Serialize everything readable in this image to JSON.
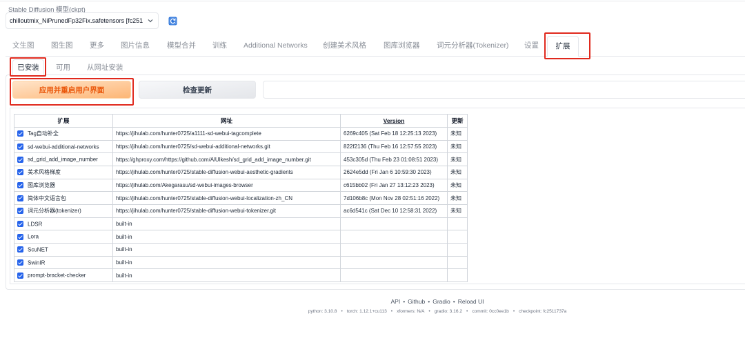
{
  "model_selector": {
    "label": "Stable Diffusion 模型(ckpt)",
    "value": "chilloutmix_NiPrunedFp32Fix.safetensors [fc251",
    "dropdown_icon": "chevron-down-icon",
    "refresh_icon": "refresh-icon"
  },
  "tabs": [
    {
      "label": "文生图"
    },
    {
      "label": "图生图"
    },
    {
      "label": "更多"
    },
    {
      "label": "图片信息"
    },
    {
      "label": "模型合并"
    },
    {
      "label": "训练"
    },
    {
      "label": "Additional Networks"
    },
    {
      "label": "创建美术风格"
    },
    {
      "label": "图库浏览器"
    },
    {
      "label": "词元分析器(Tokenizer)"
    },
    {
      "label": "设置"
    },
    {
      "label": "扩展",
      "selected": true
    }
  ],
  "subtabs": [
    {
      "label": "已安装",
      "selected": true
    },
    {
      "label": "可用"
    },
    {
      "label": "从网址安装"
    }
  ],
  "actions": {
    "apply_label": "应用并重启用户界面",
    "check_label": "检查更新"
  },
  "extensions_table": {
    "headers": {
      "name": "扩展",
      "url": "网址",
      "version": "Version",
      "update": "更新"
    },
    "rows": [
      {
        "checked": true,
        "name": "Tag自动补全",
        "url": "https://jihulab.com/hunter0725/a1111-sd-webui-tagcomplete",
        "version": "6269c405 (Sat Feb 18 12:25:13 2023)",
        "update": "未知"
      },
      {
        "checked": true,
        "name": "sd-webui-additional-networks",
        "url": "https://jihulab.com/hunter0725/sd-webui-additional-networks.git",
        "version": "822f2136 (Thu Feb 16 12:57:55 2023)",
        "update": "未知"
      },
      {
        "checked": true,
        "name": "sd_grid_add_image_number",
        "url": "https://ghproxy.com/https://github.com/AlUlkesh/sd_grid_add_image_number.git",
        "version": "453c305d (Thu Feb 23 01:08:51 2023)",
        "update": "未知"
      },
      {
        "checked": true,
        "name": "美术风格梯度",
        "url": "https://jihulab.com/hunter0725/stable-diffusion-webui-aesthetic-gradients",
        "version": "2624e5dd (Fri Jan 6 10:59:30 2023)",
        "update": "未知"
      },
      {
        "checked": true,
        "name": "图库浏览器",
        "url": "https://jihulab.com/Akegarasu/sd-webui-images-browser",
        "version": "c615bb02 (Fri Jan 27 13:12:23 2023)",
        "update": "未知"
      },
      {
        "checked": true,
        "name": "简体中文语言包",
        "url": "https://jihulab.com/hunter0725/stable-diffusion-webui-localization-zh_CN",
        "version": "7d106b8c (Mon Nov 28 02:51:16 2022)",
        "update": "未知"
      },
      {
        "checked": true,
        "name": "词元分析器(tokenizer)",
        "url": "https://jihulab.com/hunter0725/stable-diffusion-webui-tokenizer.git",
        "version": "ac6d541c (Sat Dec 10 12:58:31 2022)",
        "update": "未知"
      },
      {
        "checked": true,
        "name": "LDSR",
        "url": "built-in"
      },
      {
        "checked": true,
        "name": "Lora",
        "url": "built-in"
      },
      {
        "checked": true,
        "name": "ScuNET",
        "url": "built-in"
      },
      {
        "checked": true,
        "name": "SwinIR",
        "url": "built-in"
      },
      {
        "checked": true,
        "name": "prompt-bracket-checker",
        "url": "built-in"
      }
    ]
  },
  "footer": {
    "separator": "•",
    "links": [
      "API",
      "Github",
      "Gradio",
      "Reload UI"
    ],
    "versions": [
      "python: 3.10.8",
      "torch: 1.12.1+cu113",
      "xformers: N/A",
      "gradio: 3.16.2",
      "commit: 0cc0ee1b",
      "checkpoint: fc2511737a"
    ]
  },
  "colors": {
    "primary_button_text": "#ea580c",
    "primary_button_bg": "#fdb676",
    "checkbox": "#2563eb",
    "annotation_box": "#e0291d"
  }
}
